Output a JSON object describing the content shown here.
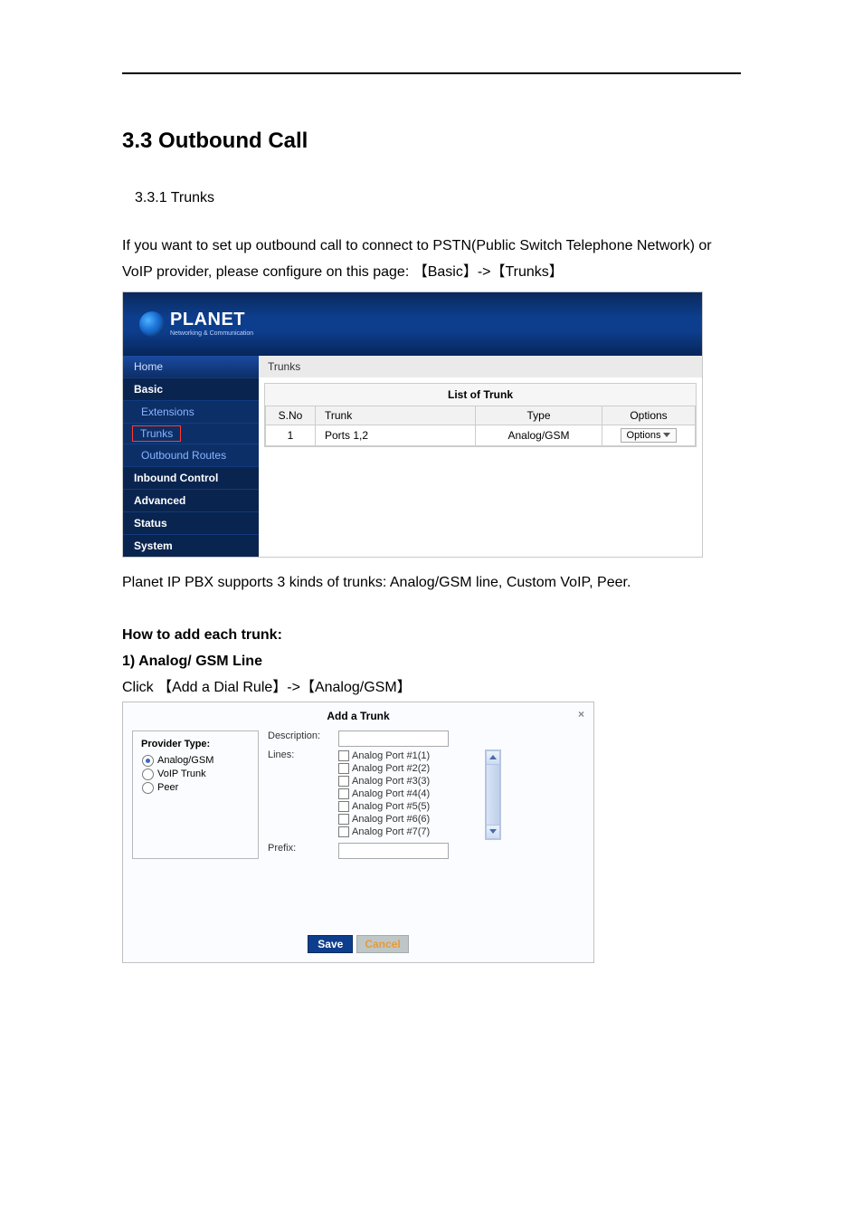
{
  "headings": {
    "h1": "3.3 Outbound Call",
    "h2": "3.3.1 Trunks"
  },
  "paragraphs": {
    "intro": "If you want to set up outbound call to connect to PSTN(Public Switch Telephone Network) or VoIP provider, please configure on this page: 【Basic】->【Trunks】",
    "after_shot": "Planet IP PBX supports 3 kinds of trunks: Analog/GSM line, Custom VoIP, Peer.",
    "howto_heading": "How to add each trunk:",
    "line1_heading": "1) Analog/ GSM Line",
    "click_line": "Click 【Add a Dial Rule】->【Analog/GSM】"
  },
  "shot1": {
    "logo_text": "PLANET",
    "logo_sub": "Networking & Communication",
    "nav": {
      "home": "Home",
      "basic": "Basic",
      "extensions": "Extensions",
      "trunks": "Trunks",
      "outbound_routes": "Outbound Routes",
      "inbound_control": "Inbound Control",
      "advanced": "Advanced",
      "status": "Status",
      "system": "System"
    },
    "crumb": "Trunks",
    "list_title": "List of Trunk",
    "columns": {
      "sno": "S.No",
      "trunk": "Trunk",
      "type": "Type",
      "options": "Options"
    },
    "row": {
      "sno": "1",
      "trunk": "Ports 1,2",
      "type": "Analog/GSM",
      "options": "Options"
    }
  },
  "modal": {
    "title": "Add a Trunk",
    "close": "×",
    "provider_type_legend": "Provider Type:",
    "radios": {
      "analog": "Analog/GSM",
      "voip": "VoIP Trunk",
      "peer": "Peer"
    },
    "labels": {
      "description": "Description:",
      "lines": "Lines:",
      "prefix": "Prefix:"
    },
    "lines": [
      "Analog Port #1(1)",
      "Analog Port #2(2)",
      "Analog Port #3(3)",
      "Analog Port #4(4)",
      "Analog Port #5(5)",
      "Analog Port #6(6)",
      "Analog Port #7(7)"
    ],
    "save": "Save",
    "cancel": "Cancel"
  }
}
